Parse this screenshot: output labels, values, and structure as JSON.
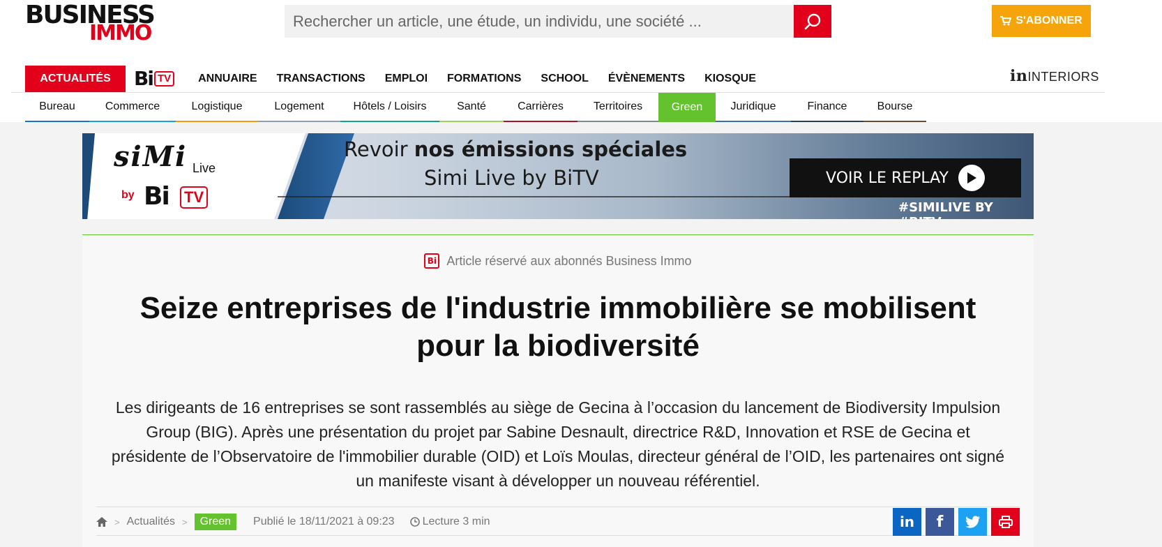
{
  "header": {
    "logo": {
      "line1": "BUSINESS",
      "line2": "IMMO"
    },
    "search": {
      "placeholder": "Rechercher un article, une étude, un individu, une société ..."
    },
    "subscribe_label": "S'ABONNER",
    "interiors": {
      "prefix": "in",
      "label": "INTERIORS"
    }
  },
  "nav": {
    "active": "ACTUALITÉS",
    "bitv": {
      "bi": "Bi",
      "tv": "TV"
    },
    "items": [
      "ANNUAIRE",
      "TRANSACTIONS",
      "EMPLOI",
      "FORMATIONS",
      "SCHOOL",
      "ÉVÈNEMENTS",
      "KIOSQUE"
    ]
  },
  "categories": [
    {
      "label": "Bureau",
      "color": "#1a73c8"
    },
    {
      "label": "Commerce",
      "color": "#1a9fd8"
    },
    {
      "label": "Logistique",
      "color": "#f39c12"
    },
    {
      "label": "Logement",
      "color": "#8e9eb3"
    },
    {
      "label": "Hôtels / Loisirs",
      "color": "#16a085"
    },
    {
      "label": "Santé",
      "color": "#9fd05b"
    },
    {
      "label": "Carrières",
      "color": "#a01828"
    },
    {
      "label": "Territoires",
      "color": "#7f8c8d"
    },
    {
      "label": "Green",
      "color": "#65c22f"
    },
    {
      "label": "Juridique",
      "color": "#3d6fa5"
    },
    {
      "label": "Finance",
      "color": "#2c3e50"
    },
    {
      "label": "Bourse",
      "color": "#6b4a2f"
    }
  ],
  "banner": {
    "simi": "siMi",
    "live": "Live",
    "by": "by",
    "bi": "Bi",
    "tv": "TV",
    "headline_prefix": "Revoir ",
    "headline_bold": "nos émissions spéciales",
    "subline": "Simi Live by BiTV",
    "cta": "VOIR LE REPLAY",
    "hashtag": "#SIMILIVE BY #BITV"
  },
  "article": {
    "badge": "Bi",
    "reserved": "Article réservé aux abonnés Business Immo",
    "title": "Seize entreprises de l'industrie immobilière se mobilisent pour la biodiversité",
    "lead": "Les dirigeants de 16 entreprises se sont rassemblés au siège de Gecina à l’occasion du lancement de Biodiversity Impulsion Group (BIG). Après une présentation du projet par Sabine Desnault, directrice R&D, Innovation et RSE de Gecina et présidente de l’Observatoire de l'immobilier durable (OID) et Loïs Moulas, directeur général de l’OID, les partenaires ont signé un manifeste visant à développer un nouveau référentiel.",
    "breadcrumb": {
      "section": "Actualités",
      "tag": "Green"
    },
    "published": "Publié le 18/11/2021 à 09:23",
    "reading_time": "Lecture 3 min"
  },
  "share": {
    "linkedin": "in",
    "facebook": "f"
  }
}
